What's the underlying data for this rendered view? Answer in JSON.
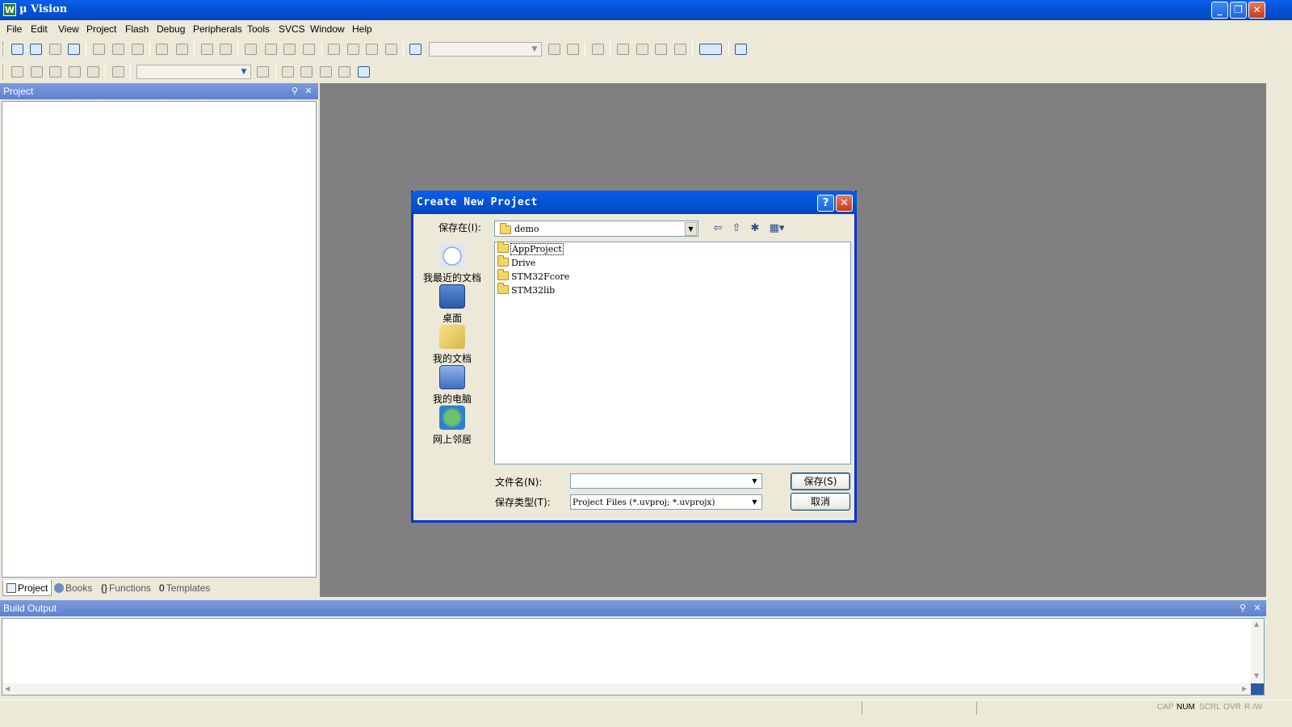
{
  "window": {
    "title": "µ Vision",
    "icon_letter": "W",
    "minimize": "_",
    "maximize": "❐",
    "close": "✕"
  },
  "menu": [
    "File",
    "Edit",
    "View",
    "Project",
    "Flash",
    "Debug",
    "Peripherals",
    "Tools",
    "SVCS",
    "Window",
    "Help"
  ],
  "project_panel": {
    "title": "Project",
    "tabs": [
      {
        "label": "Project",
        "icon": "project-icon"
      },
      {
        "label": "Books",
        "icon": "books-icon"
      },
      {
        "label": "Functions",
        "icon": "functions-icon",
        "glyph": "{}"
      },
      {
        "label": "Templates",
        "icon": "templates-icon",
        "glyph": "0"
      }
    ]
  },
  "dialog": {
    "title": "Create New Project",
    "help_btn": "?",
    "close_btn": "✕",
    "save_in_label": "保存在(I):",
    "save_in_value": "demo",
    "places": [
      "我最近的文档",
      "桌面",
      "我的文档",
      "我的电脑",
      "网上邻居"
    ],
    "files": [
      "AppProject",
      "Drive",
      "STM32Fcore",
      "STM32lib"
    ],
    "filename_label": "文件名(N):",
    "filename_value": "",
    "filetype_label": "保存类型(T):",
    "filetype_value": "Project Files (*.uvproj; *.uvprojx)",
    "save_button": "保存(S)",
    "cancel_button": "取消"
  },
  "build_output": {
    "title": "Build Output"
  },
  "status": {
    "indicators": [
      "CAP",
      "NUM",
      "SCRL",
      "OVR",
      "R /W"
    ],
    "active": "NUM"
  },
  "colors": {
    "titlebar": "#0355D8",
    "panel_header": "#6A8DD6",
    "mdi_background": "#808080",
    "chrome": "#ECE9D8"
  }
}
